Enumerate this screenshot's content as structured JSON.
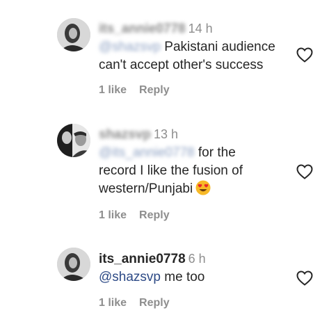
{
  "comments": [
    {
      "username": "its_annie0778",
      "username_blurred": true,
      "time": "14 h",
      "mention": "@shazsvp",
      "mention_blurred": true,
      "text_line1": " Pakistani audience",
      "text_line2": "can't accept other's success",
      "likes": "1 like",
      "reply": "Reply"
    },
    {
      "username": "shazsvp",
      "username_blurred": true,
      "time": "13 h",
      "mention": "@its_annie0778",
      "mention_blurred": true,
      "text_line1": " for the",
      "text_line2": "record I like the fusion of",
      "text_line3": "western/Punjabi",
      "emoji": "heart-eyes-emoji",
      "likes": "1 like",
      "reply": "Reply"
    },
    {
      "username": "its_annie0778",
      "username_blurred": false,
      "time": "6 h",
      "mention": "@shazsvp",
      "mention_blurred": false,
      "text_line1": " me too",
      "likes": "1 like",
      "reply": "Reply"
    }
  ],
  "icons": {
    "like": "heart-outline-icon"
  },
  "colors": {
    "mention": "#2d4a86",
    "meta": "#8e8e8e",
    "text": "#262626"
  }
}
